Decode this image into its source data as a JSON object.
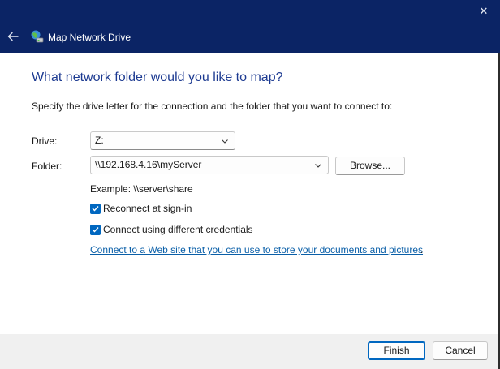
{
  "window": {
    "title": "Map Network Drive",
    "close_glyph": "✕",
    "icons": {
      "back": "back-arrow-icon",
      "app": "network-drive-icon",
      "close": "close-icon"
    }
  },
  "dialog": {
    "heading": "What network folder would you like to map?",
    "instructions": "Specify the drive letter for the connection and the folder that you want to connect to:",
    "drive": {
      "label": "Drive:",
      "value": "Z:"
    },
    "folder": {
      "label": "Folder:",
      "value": "\\\\192.168.4.16\\myServer",
      "browse_label": "Browse..."
    },
    "example": "Example: \\\\server\\share",
    "reconnect": {
      "label": "Reconnect at sign-in",
      "checked": true
    },
    "credentials": {
      "label": "Connect using different credentials",
      "checked": true
    },
    "web_link": "Connect to a Web site that you can use to store your documents and pictures",
    "web_link_suffix": "."
  },
  "footer": {
    "finish_label": "Finish",
    "cancel_label": "Cancel"
  },
  "colors": {
    "titlebar": "#0b2465",
    "heading": "#1c3a91",
    "accent": "#0067c0",
    "link": "#0a5fa8"
  }
}
